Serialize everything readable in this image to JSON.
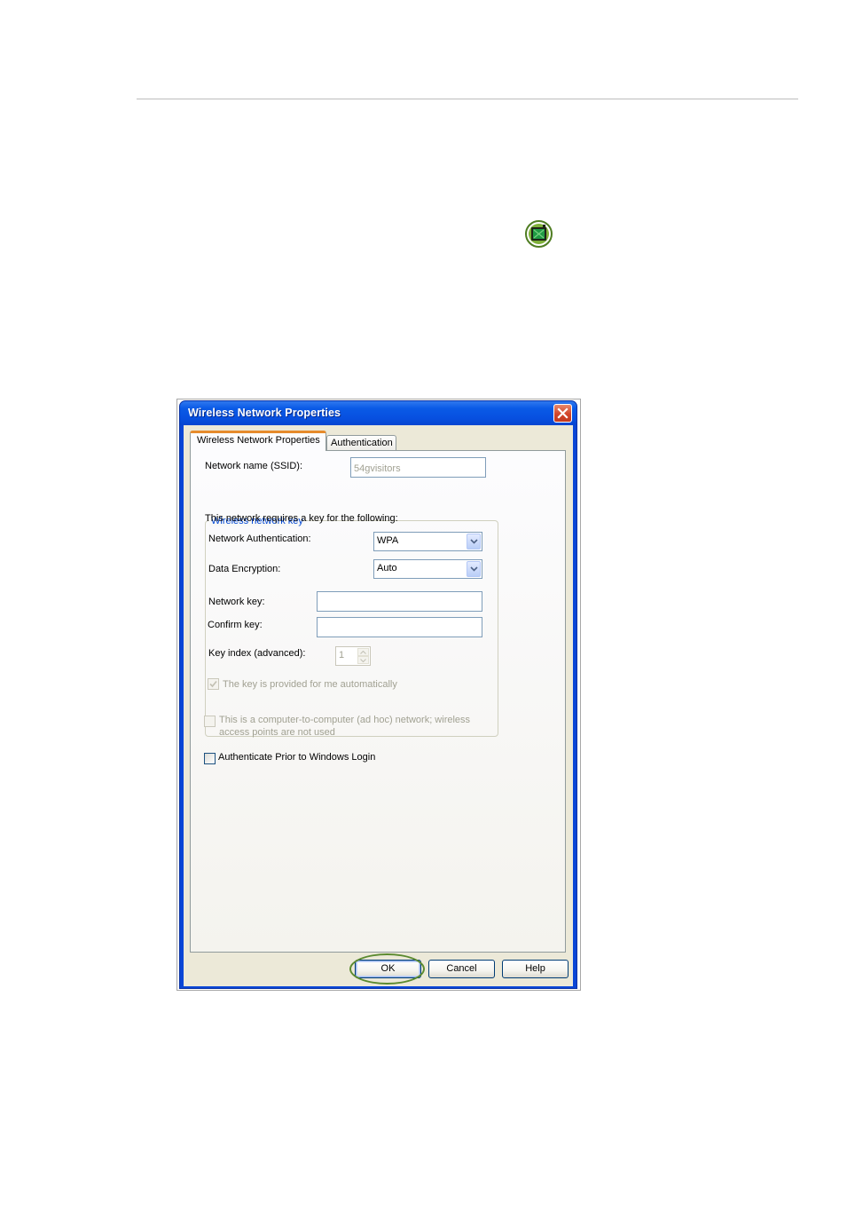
{
  "page": {
    "status_icon": "network-status-icon"
  },
  "dialog": {
    "title": "Wireless Network Properties",
    "close_icon": "close-icon",
    "tabs": [
      {
        "label": "Wireless Network Properties",
        "active": true
      },
      {
        "label": "Authentication",
        "active": false
      }
    ],
    "ssid_label": "Network name (SSID):",
    "ssid_value": "54gvisitors",
    "group_title": "Wireless network key",
    "requires_text": "This network requires a key for the following:",
    "auth_label": "Network Authentication:",
    "auth_value": "WPA",
    "encryption_label": "Data Encryption:",
    "encryption_value": "Auto",
    "network_key_label": "Network key:",
    "network_key_value": "",
    "confirm_key_label": "Confirm key:",
    "confirm_key_value": "",
    "key_index_label": "Key index (advanced):",
    "key_index_value": "1",
    "auto_key_label": "The key is provided for me automatically",
    "auto_key_checked": true,
    "adhoc_label_line1": "This is a computer-to-computer (ad hoc) network; wireless",
    "adhoc_label_line2": "access points are not used",
    "adhoc_checked": false,
    "prior_login_label": "Authenticate Prior to Windows Login",
    "prior_login_checked": false,
    "buttons": {
      "ok": "OK",
      "cancel": "Cancel",
      "help": "Help"
    }
  },
  "colors": {
    "titlebar": "#0a5ae6",
    "dialog_face": "#ece9d8",
    "group_title": "#0046d5",
    "highlight_ring": "#5b8a2f",
    "active_tab_accent": "#e68b2c"
  }
}
